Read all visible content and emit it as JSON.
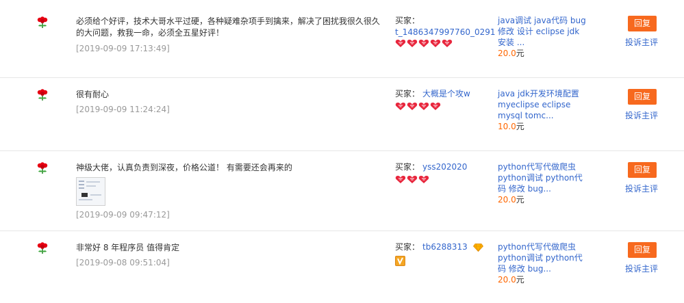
{
  "labels": {
    "buyer": "买家：",
    "reply": "回复",
    "complain": "投诉主评",
    "currency": "元"
  },
  "colors": {
    "accent": "#f7691e",
    "link": "#3366cc",
    "price": "#ff6600",
    "muted": "#999999"
  },
  "reviews": [
    {
      "comment": "必须给个好评，技术大哥水平过硬，各种疑难杂项手到擒来，解决了困扰我很久很久的大问题，救我一命，必须全五星好评！",
      "timestamp": "[2019-09-09 17:13:49]",
      "buyer": "t_1486347997760_0291",
      "buyer_hearts": 5,
      "product": "java调试 java代码 bug 修改 设计 eclipse jdk 安装 ...",
      "price": "20.0"
    },
    {
      "comment": "很有耐心",
      "timestamp": "[2019-09-09 11:24:24]",
      "buyer": "大概是个攻w",
      "buyer_hearts": 4,
      "product": "java jdk开发环境配置 myeclipse eclipse mysql tomc...",
      "price": "10.0"
    },
    {
      "comment": "神级大佬，认真负责到深夜，价格公道！ 有需要还会再来的",
      "timestamp": "[2019-09-09 09:47:12]",
      "buyer": "yss202020",
      "buyer_hearts": 3,
      "product": "python代写代做爬虫 python调试 python代码 修改 bug...",
      "price": "20.0"
    },
    {
      "comment": "非常好 8 年程序员 值得肯定",
      "timestamp": "[2019-09-08 09:51:04]",
      "buyer": "tb6288313",
      "buyer_icon": "diamond-icon",
      "product": "python代写代做爬虫 python调试 python代码 修改 bug...",
      "price": "20.0"
    }
  ]
}
